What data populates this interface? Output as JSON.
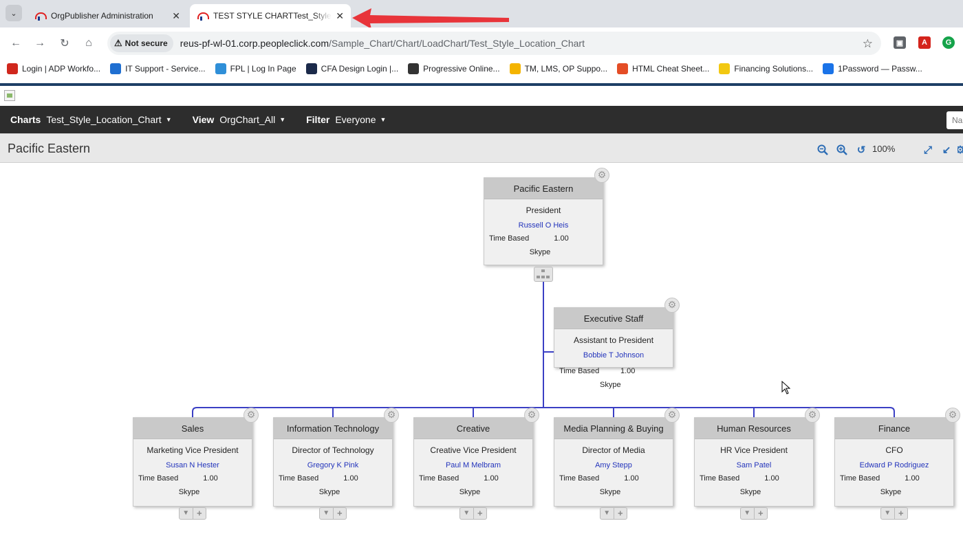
{
  "browser": {
    "tabs": [
      {
        "title": "OrgPublisher Administration",
        "active": false
      },
      {
        "title": "TEST STYLE CHARTTest_Style_Location_Chart",
        "active": true
      }
    ],
    "security_label": "Not secure",
    "url_host": "reus-pf-wl-01.corp.peopleclick.com",
    "url_path": "/Sample_Chart/Chart/LoadChart/Test_Style_Location_Chart",
    "bookmarks": [
      {
        "label": "Login | ADP Workfo...",
        "icon": "adp-icon",
        "color": "#d0271d"
      },
      {
        "label": "IT Support - Service...",
        "icon": "servicenow-icon",
        "color": "#1f6fd1"
      },
      {
        "label": "FPL | Log In Page",
        "icon": "fpl-icon",
        "color": "#2f8fd8"
      },
      {
        "label": "CFA Design Login |...",
        "icon": "cfa-icon",
        "color": "#1b2a4a"
      },
      {
        "label": "Progressive Online...",
        "icon": "globe-icon",
        "color": "#333333"
      },
      {
        "label": "TM, LMS, OP Suppo...",
        "icon": "google-drive-icon",
        "color": "#f4b400"
      },
      {
        "label": "HTML Cheat Sheet...",
        "icon": "html5-icon",
        "color": "#e44d26"
      },
      {
        "label": "Financing Solutions...",
        "icon": "power-bi-icon",
        "color": "#f2c811"
      },
      {
        "label": "1Password — Passw...",
        "icon": "onepassword-icon",
        "color": "#1a73e8"
      }
    ]
  },
  "app": {
    "charts_label": "Charts",
    "charts_value": "Test_Style_Location_Chart",
    "view_label": "View",
    "view_value": "OrgChart_All",
    "filter_label": "Filter",
    "filter_value": "Everyone",
    "search_placeholder": "Na",
    "page_title": "Pacific Eastern",
    "zoom_level": "100%"
  },
  "org": {
    "root": {
      "unit": "Pacific Eastern",
      "title": "President",
      "person": "Russell O Heis",
      "type_label": "Time Based",
      "fte": "1.00",
      "contact": "Skype"
    },
    "assistant": {
      "unit": "Executive Staff",
      "title": "Assistant to President",
      "person": "Bobbie T Johnson",
      "type_label": "Time Based",
      "fte": "1.00",
      "contact": "Skype"
    },
    "departments": [
      {
        "unit": "Sales",
        "title": "Marketing Vice President",
        "person": "Susan N Hester",
        "type_label": "Time Based",
        "fte": "1.00",
        "contact": "Skype"
      },
      {
        "unit": "Information Technology",
        "title": "Director of Technology",
        "person": "Gregory K Pink",
        "type_label": "Time Based",
        "fte": "1.00",
        "contact": "Skype"
      },
      {
        "unit": "Creative",
        "title": "Creative Vice President",
        "person": "Paul M Melbram",
        "type_label": "Time Based",
        "fte": "1.00",
        "contact": "Skype"
      },
      {
        "unit": "Media Planning & Buying",
        "title": "Director of Media",
        "person": "Amy Stepp",
        "type_label": "Time Based",
        "fte": "1.00",
        "contact": "Skype"
      },
      {
        "unit": "Human Resources",
        "title": "HR Vice President",
        "person": "Sam Patel",
        "type_label": "Time Based",
        "fte": "1.00",
        "contact": "Skype"
      },
      {
        "unit": "Finance",
        "title": "CFO",
        "person": "Edward P Rodriguez",
        "type_label": "Time Based",
        "fte": "1.00",
        "contact": "Skype"
      }
    ]
  },
  "colors": {
    "connector": "#3a3fc4",
    "link": "#2233bb",
    "accent": "#2d6db5",
    "arrow": "#e8343a"
  }
}
